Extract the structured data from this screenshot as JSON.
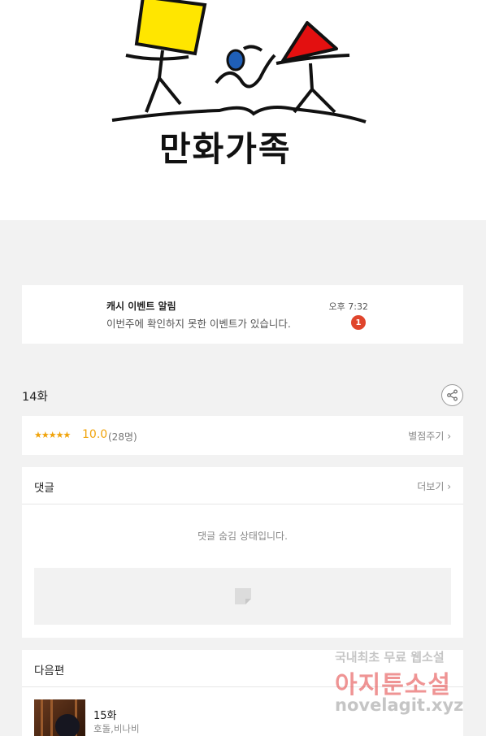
{
  "brand": {
    "logo_text": "만화가족"
  },
  "notification": {
    "title": "캐시 이벤트 알림",
    "message": "이번주에 확인하지 못한 이벤트가 있습니다.",
    "time": "오후 7:32",
    "badge_count": "1"
  },
  "episode": {
    "title": "14화"
  },
  "rating": {
    "stars": "★★★★★",
    "score": "10.0",
    "votes": "(28명)",
    "rate_label": "별점주기 ›"
  },
  "comments": {
    "title": "댓글",
    "more_label": "더보기 ›",
    "hidden_message": "댓글 숨김 상태입니다."
  },
  "next_episode": {
    "section_title": "다음편",
    "title": "15화",
    "author": "호돌,비나비"
  },
  "watermark": {
    "line1": "국내최초 무료 웹소설",
    "line2": "아지툰소설",
    "line3": "novelagit.xyz"
  },
  "colors": {
    "accent": "#f0a30a",
    "badge": "#e0452c",
    "page_bg": "#f2f2f2"
  }
}
